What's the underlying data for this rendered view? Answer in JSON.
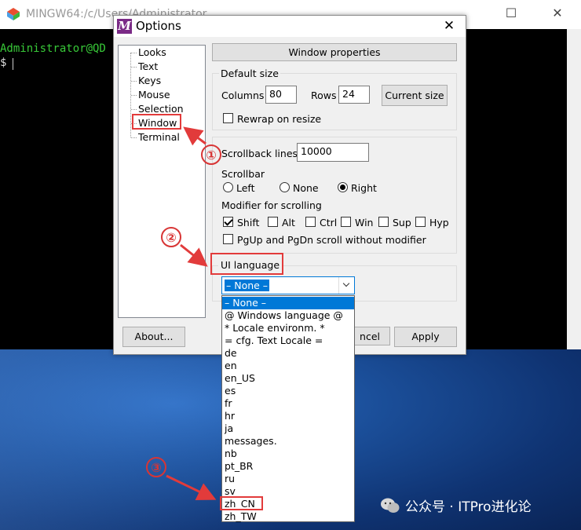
{
  "terminal": {
    "title": "MINGW64:/c/Users/Administrator",
    "prompt": "Administrator@QD",
    "dollar": "$",
    "minimize_glyph": "☐",
    "close_glyph": "✕",
    "icon": "git-bash-icon"
  },
  "dialog": {
    "title": "Options",
    "icon_letter": "M",
    "close_glyph": "✕",
    "tree": [
      "Looks",
      "Text",
      "Keys",
      "Mouse",
      "Selection",
      "Window",
      "Terminal"
    ],
    "window_properties_button": "Window properties",
    "default_size": {
      "legend": "Default size",
      "columns_label": "Columns",
      "columns_value": "80",
      "rows_label": "Rows",
      "rows_value": "24",
      "current_size_button": "Current size",
      "rewrap_label": "Rewrap on resize"
    },
    "scrollback": {
      "label": "Scrollback lines",
      "value": "10000"
    },
    "scrollbar": {
      "label": "Scrollbar",
      "left": "Left",
      "none": "None",
      "right": "Right",
      "selected": "Right"
    },
    "modifier": {
      "label": "Modifier for scrolling",
      "shift": "Shift",
      "alt": "Alt",
      "ctrl": "Ctrl",
      "win": "Win",
      "sup": "Sup",
      "hyp": "Hyp",
      "pgup_label": "PgUp and PgDn scroll without modifier"
    },
    "ui_language": {
      "label": "UI language",
      "selected": "– None –",
      "options": [
        "– None –",
        "@ Windows language @",
        "* Locale environm. *",
        "= cfg. Text Locale =",
        "de",
        "en",
        "en_US",
        "es",
        "fr",
        "hr",
        "ja",
        "messages.",
        "nb",
        "pt_BR",
        "ru",
        "sv",
        "zh_CN",
        "zh_TW"
      ]
    },
    "about_button": "About...",
    "cancel_button": "ncel",
    "apply_button": "Apply"
  },
  "annotations": {
    "step1": "①",
    "step2": "②",
    "step3": "③",
    "color": "#e23b3b"
  },
  "watermark": "公众号 · ITPro进化论"
}
